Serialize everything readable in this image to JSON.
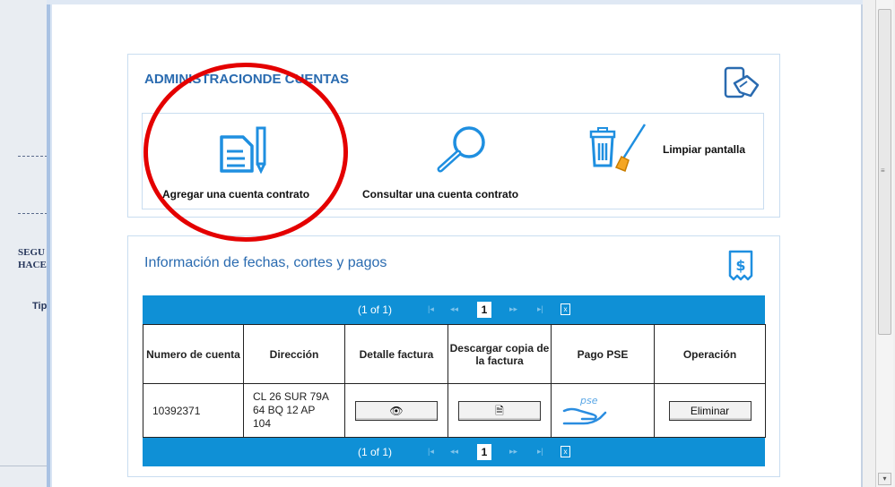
{
  "background_page": {
    "left_labels": [
      "SEGU",
      "HACE"
    ],
    "tipo_label": "Tipo"
  },
  "admin_panel": {
    "title": "ADMINISTRACIONDE CUENTAS",
    "actions": {
      "add_contract": "Agregar una cuenta contrato",
      "consult_contract": "Consultar una cuenta contrato",
      "clear_screen": "Limpiar pantalla"
    }
  },
  "info_panel": {
    "title": "Información de fechas, cortes y pagos"
  },
  "table": {
    "pager_text": "(1 of 1)",
    "current_page": "1",
    "headers": [
      "Numero de cuenta",
      "Dirección",
      "Detalle factura",
      "Descargar copia de la factura",
      "Pago PSE",
      "Operación"
    ],
    "rows": [
      {
        "account_number": "10392371",
        "address": "CL 26 SUR 79A 64 BQ 12 AP 104",
        "pse_label": "pse",
        "delete_label": "Eliminar"
      }
    ]
  },
  "icons": {
    "admin_header": "mobile-hand-icon",
    "info_header": "receipt-dollar-icon",
    "add": "document-pencil-icon",
    "consult": "magnifier-icon",
    "clear": "trash-broom-icon"
  },
  "colors": {
    "accent_blue": "#2a6bb0",
    "pager_blue": "#0f90d6",
    "annotation_red": "#e40000"
  }
}
